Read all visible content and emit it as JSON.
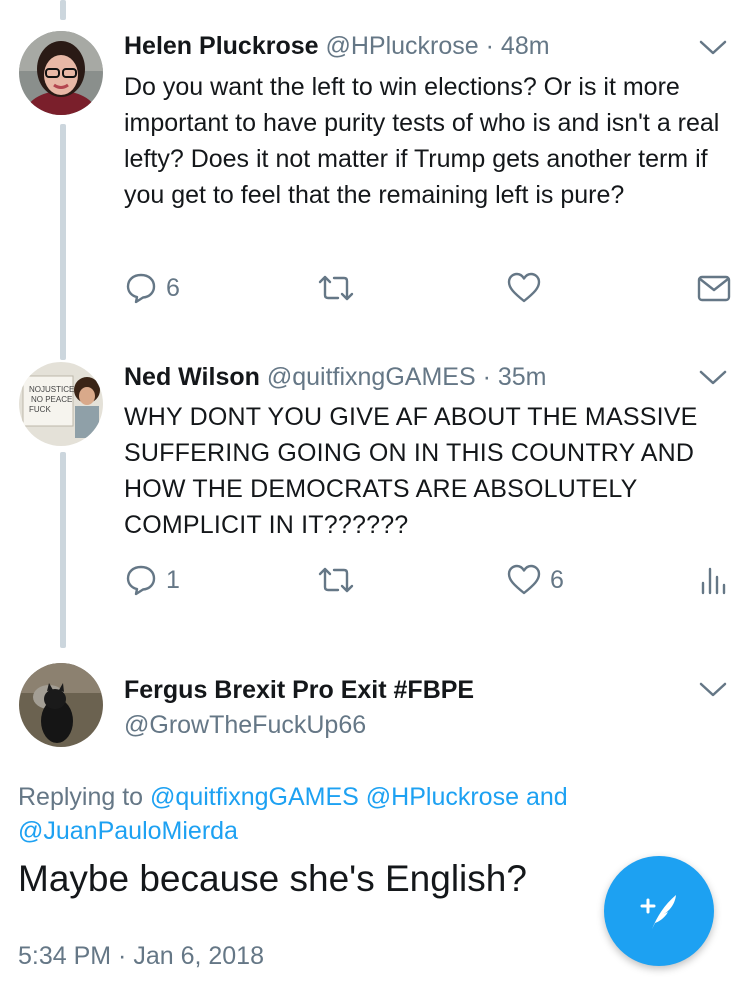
{
  "tweets": [
    {
      "name": "Helen Pluckrose",
      "handle": "@HPluckrose",
      "time": "48m",
      "text": "Do you want the left to win elections? Or is it more important to have purity tests of who is and isn't a real lefty? Does it not matter if Trump gets another term if you get to feel that the remaining left is pure?",
      "reply_count": "6"
    },
    {
      "name": "Ned Wilson",
      "handle": "@quitfixngGAMES",
      "time": "35m",
      "text": "WHY DONT YOU GIVE AF ABOUT THE MASSIVE SUFFERING GOING ON IN THIS COUNTRY AND HOW THE DEMOCRATS ARE ABSOLUTELY COMPLICIT IN IT??????",
      "reply_count": "1",
      "like_count": "6"
    }
  ],
  "main_tweet": {
    "name": "Fergus Brexit Pro Exit #FBPE",
    "handle": "@GrowTheFuckUp66",
    "replying_prefix": "Replying to",
    "mention1": "@quitfixngGAMES",
    "mention2": "@HPluckrose",
    "and": "and",
    "mention3": "@JuanPauloMierda",
    "text": "Maybe because she's English?",
    "timestamp": "5:34 PM · Jan 6, 2018"
  },
  "separator": "·",
  "colors": {
    "accent": "#1da1f2",
    "muted": "#657786",
    "text": "#14171a",
    "thread_line": "#ccd6dd"
  },
  "icons": [
    "reply-icon",
    "retweet-icon",
    "like-icon",
    "message-icon",
    "analytics-icon",
    "chevron-down-icon",
    "compose-tweet-icon"
  ]
}
